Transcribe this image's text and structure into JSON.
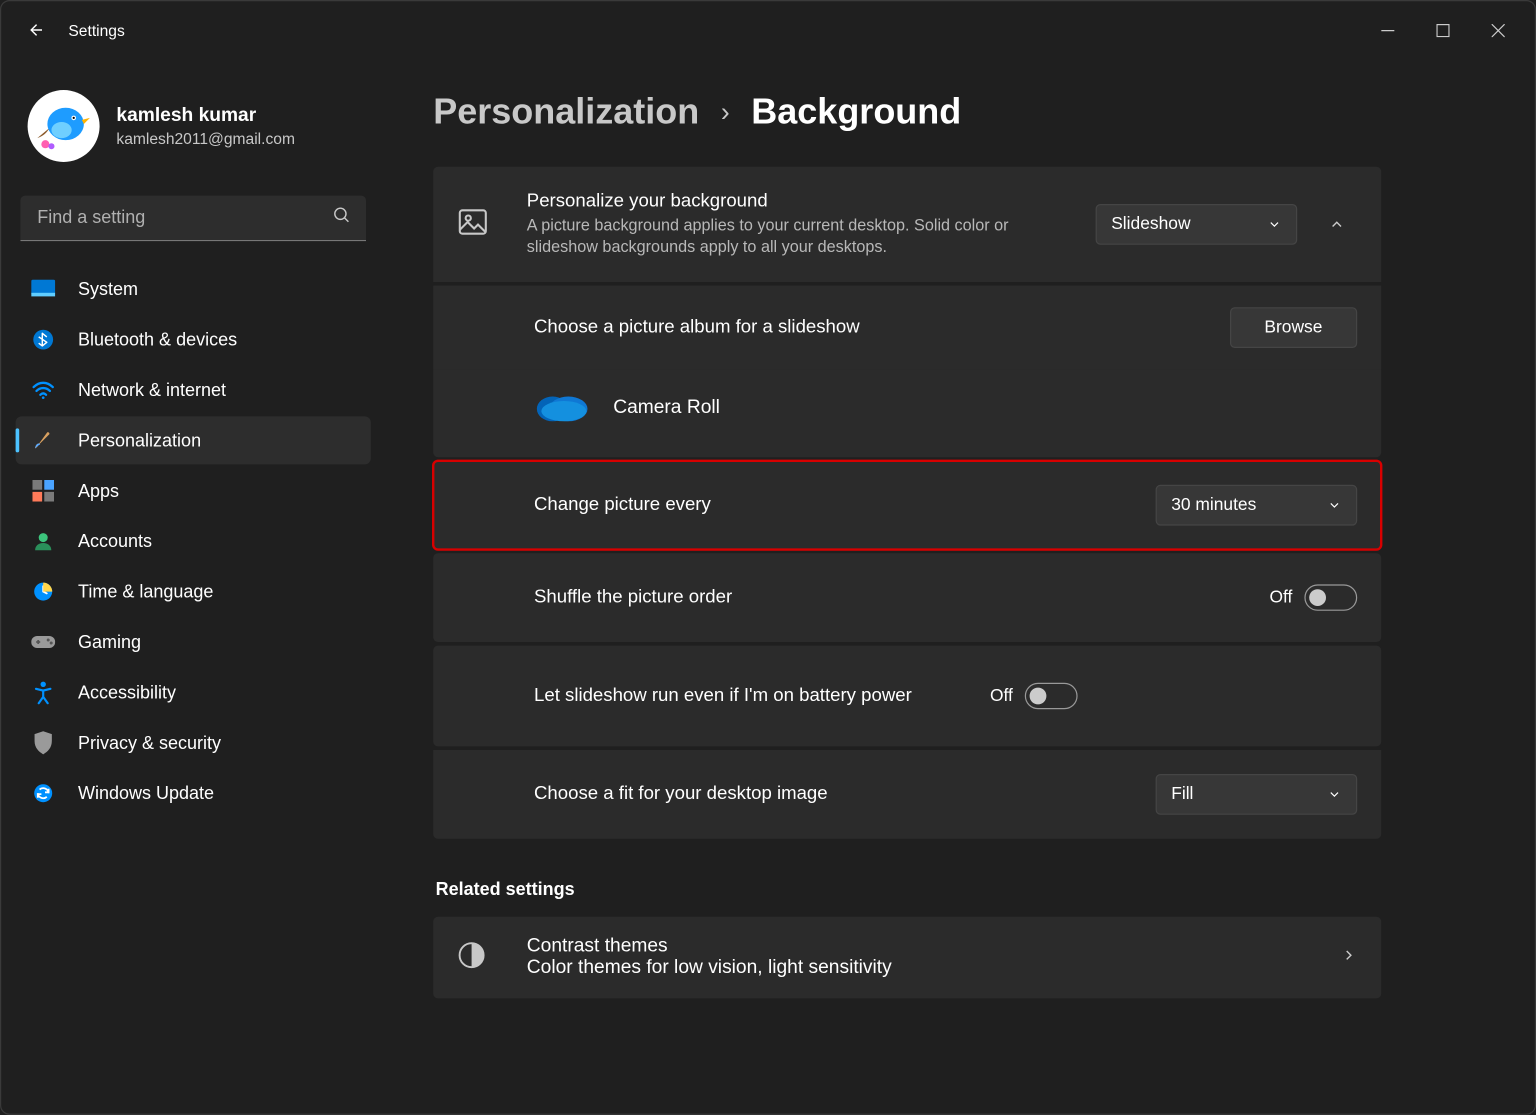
{
  "window": {
    "title": "Settings"
  },
  "profile": {
    "name": "kamlesh kumar",
    "email": "kamlesh2011@gmail.com"
  },
  "search": {
    "placeholder": "Find a setting"
  },
  "sidebar": {
    "items": [
      {
        "label": "System"
      },
      {
        "label": "Bluetooth & devices"
      },
      {
        "label": "Network & internet"
      },
      {
        "label": "Personalization"
      },
      {
        "label": "Apps"
      },
      {
        "label": "Accounts"
      },
      {
        "label": "Time & language"
      },
      {
        "label": "Gaming"
      },
      {
        "label": "Accessibility"
      },
      {
        "label": "Privacy & security"
      },
      {
        "label": "Windows Update"
      }
    ]
  },
  "breadcrumb": {
    "parent": "Personalization",
    "sep": "›",
    "current": "Background"
  },
  "panel": {
    "personalize": {
      "title": "Personalize your background",
      "desc": "A picture background applies to your current desktop. Solid color or slideshow backgrounds apply to all your desktops.",
      "dropdown": "Slideshow"
    },
    "album": {
      "title": "Choose a picture album for a slideshow",
      "button": "Browse",
      "current": "Camera Roll"
    },
    "interval": {
      "title": "Change picture every",
      "value": "30 minutes"
    },
    "shuffle": {
      "title": "Shuffle the picture order",
      "toggle": "Off"
    },
    "battery": {
      "title": "Let slideshow run even if I'm on battery power",
      "toggle": "Off"
    },
    "fit": {
      "title": "Choose a fit for your desktop image",
      "value": "Fill"
    },
    "related_heading": "Related settings",
    "contrast": {
      "title": "Contrast themes",
      "desc": "Color themes for low vision, light sensitivity"
    }
  }
}
